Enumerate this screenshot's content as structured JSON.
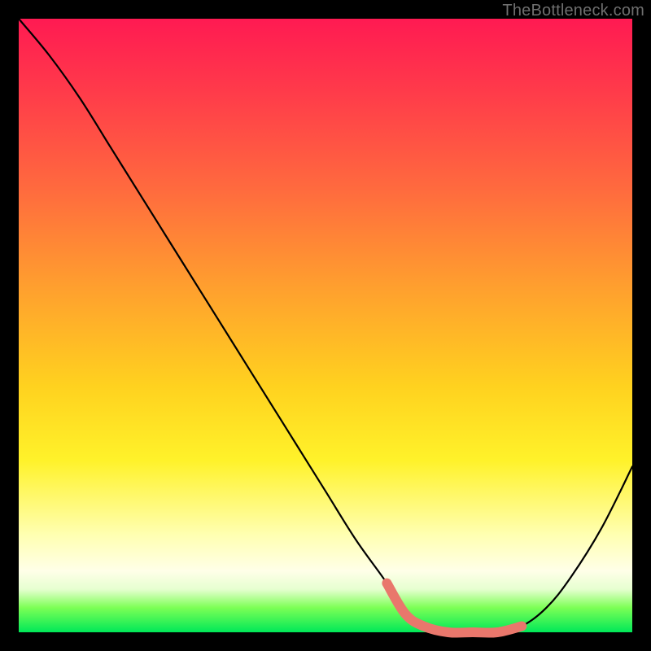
{
  "watermark": "TheBottleneck.com",
  "colors": {
    "background": "#000000",
    "curve": "#000000",
    "highlight": "#e9776c",
    "gradient_top": "#ff1a52",
    "gradient_bottom": "#00e858"
  },
  "chart_data": {
    "type": "line",
    "title": "",
    "xlabel": "",
    "ylabel": "",
    "xlim": [
      0,
      100
    ],
    "ylim": [
      0,
      100
    ],
    "grid": false,
    "x": [
      0,
      5,
      10,
      15,
      20,
      25,
      30,
      35,
      40,
      45,
      50,
      55,
      60,
      63,
      66,
      70,
      74,
      78,
      82,
      86,
      90,
      95,
      100
    ],
    "series": [
      {
        "name": "bottleneck-curve",
        "values": [
          100,
          94,
          87,
          79,
          71,
          63,
          55,
          47,
          39,
          31,
          23,
          15,
          8,
          3,
          1,
          0,
          0,
          0,
          1,
          4,
          9,
          17,
          27
        ]
      }
    ],
    "highlight_range_x": [
      60,
      82
    ],
    "note": "Values are read off the figure; the curve is a steep descending line from the top-left that bottoms out near x≈70–80 at y≈0 and rises again toward the right. The salmon highlight marks the flat minimum region."
  }
}
